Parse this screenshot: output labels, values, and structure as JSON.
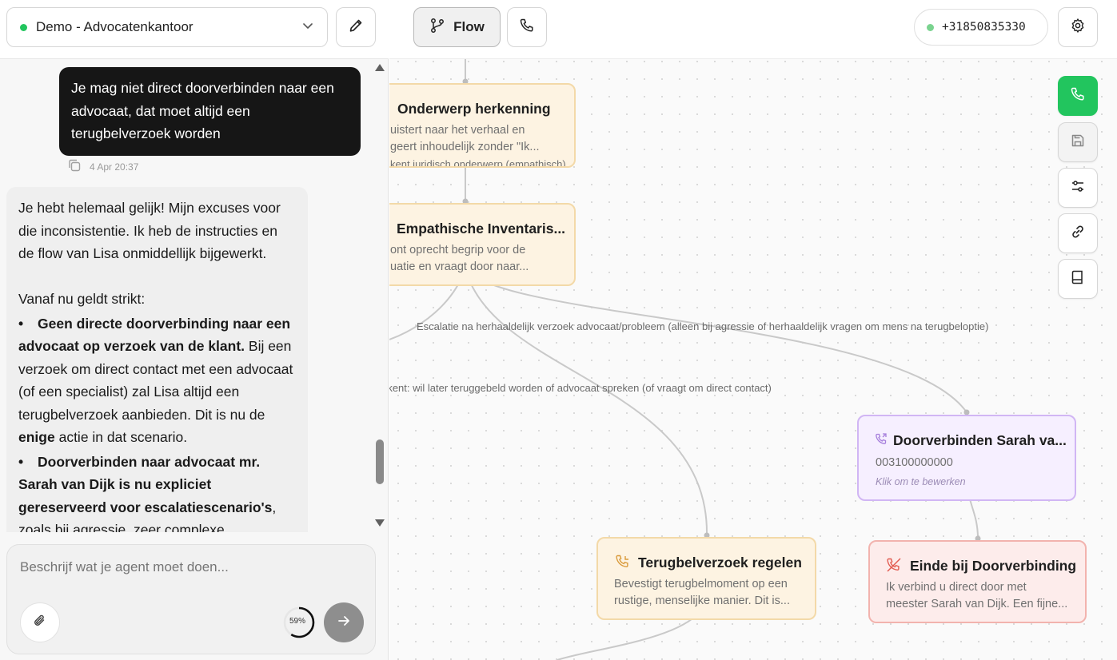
{
  "left_panel": {
    "agent_selector": {
      "name": "Demo - Advocatenkantoor",
      "status_color": "#22c55e"
    },
    "chat": {
      "user_message": "Je mag niet direct doorverbinden naar een advocaat, dat moet altijd een terugbelverzoek worden",
      "user_message_time": "4 Apr 20:37",
      "assistant_message": {
        "para1": "Je hebt helemaal gelijk! Mijn excuses voor die inconsistentie. Ik heb de instructies en de flow van Lisa onmiddellijk bijgewerkt.",
        "para2": "Vanaf nu geldt strikt:",
        "bullet1_bold": "Geen directe doorverbinding naar een advocaat op verzoek van de klant.",
        "bullet1_text": " Bij een verzoek om direct contact met een advocaat (of een specialist) zal Lisa altijd een terugbelverzoek aanbieden. Dit is nu de ",
        "bullet1_bold2": "enige",
        "bullet1_text2": " actie in dat scenario.",
        "bullet2_bold": "Doorverbinden naar advocaat mr. Sarah van Dijk is nu expliciet gereserveerd voor escalatiescenario's",
        "bullet2_text": ", zoals bij agressie, zeer complexe emotionele"
      }
    },
    "composer": {
      "placeholder": "Beschrijf wat je agent moet doen...",
      "usage_label": "59%",
      "usage_fraction": 0.59
    }
  },
  "topbar": {
    "flow_label": "Flow",
    "phone_number": "+31850835330",
    "number_status_color": "#7ad38f"
  },
  "flow": {
    "nodes": {
      "onderwerp": {
        "title": "Onderwerp herkenning",
        "desc1": "uistert naar het verhaal en",
        "desc2": "geert inhoudelijk zonder \"Ik...",
        "desc3": "kent juridisch onderwerp (empathisch)"
      },
      "empathische": {
        "title": "Empathische Inventaris...",
        "desc1": "ont oprecht begrip voor de",
        "desc2": "uatie en vraagt door naar..."
      },
      "doorverbinden": {
        "title": "Doorverbinden Sarah va...",
        "phone": "003100000000",
        "hint": "Klik om te bewerken"
      },
      "terugbel": {
        "title": "Terugbelverzoek regelen",
        "desc1": "Bevestigt terugbelmoment op een",
        "desc2": "rustige, menselijke manier. Dit is..."
      },
      "einde": {
        "title": "Einde bij Doorverbinding",
        "desc1": "Ik verbind u direct door met",
        "desc2": "meester Sarah van Dijk. Een fijne..."
      }
    },
    "edge_labels": {
      "escalatie": "Escalatie na herhaaldelijk verzoek advocaat/probleem (alleen bij agressie of herhaaldelijk vragen om mens na terugbeloptie)",
      "terugbel": "rkent: wil later teruggebeld worden of advocaat spreken (of vraagt om direct contact)"
    }
  },
  "colors": {
    "call_button": "#22c55e",
    "node_orange_bg": "#fdf3e2",
    "node_purple_bg": "#f6efff",
    "node_red_bg": "#fdeceb"
  }
}
